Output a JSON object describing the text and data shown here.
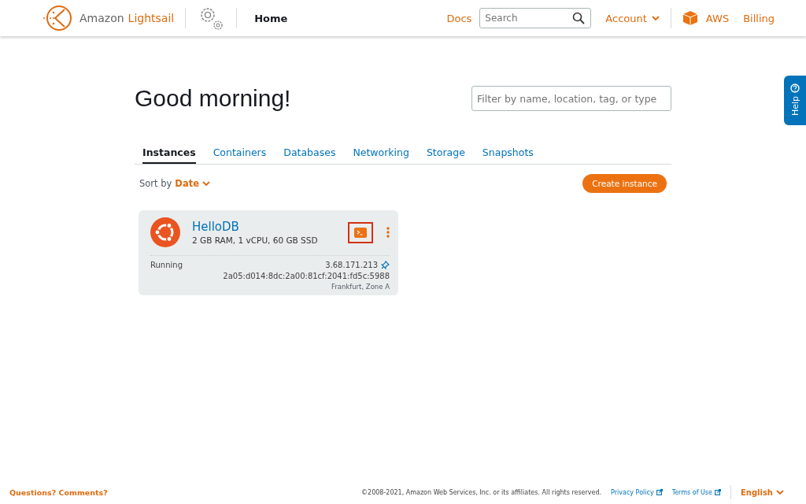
{
  "header": {
    "brand": {
      "first": "Amazon",
      "second": "Lightsail"
    },
    "page": "Home",
    "docs": "Docs",
    "search": {
      "placeholder": "Search"
    },
    "account": "Account",
    "aws": "AWS",
    "billing": "Billing"
  },
  "help": "Help",
  "greeting": "Good morning!",
  "filter": {
    "placeholder": "Filter by name, location, tag, or type"
  },
  "tabs": [
    {
      "label": "Instances",
      "selected": true
    },
    {
      "label": "Containers",
      "selected": false
    },
    {
      "label": "Databases",
      "selected": false
    },
    {
      "label": "Networking",
      "selected": false
    },
    {
      "label": "Storage",
      "selected": false
    },
    {
      "label": "Snapshots",
      "selected": false
    }
  ],
  "sort": {
    "label": "Sort by",
    "value": "Date"
  },
  "create_button": "Create instance",
  "instances": [
    {
      "name": "HelloDB",
      "specs": "2 GB RAM, 1 vCPU, 60 GB SSD",
      "status": "Running",
      "ipv4": "3.68.171.213",
      "ipv6": "2a05:d014:8dc:2a00:81cf:2041:fd5c:5988",
      "location": "Frankfurt, Zone A",
      "connect_highlighted": true
    }
  ],
  "footer": {
    "feedback": "Questions? Comments?",
    "copyright": "©2008-2021, Amazon Web Services, Inc. or its affiliates. All rights reserved.",
    "links": [
      "Privacy Policy",
      "Terms of Use"
    ],
    "language": "English"
  }
}
